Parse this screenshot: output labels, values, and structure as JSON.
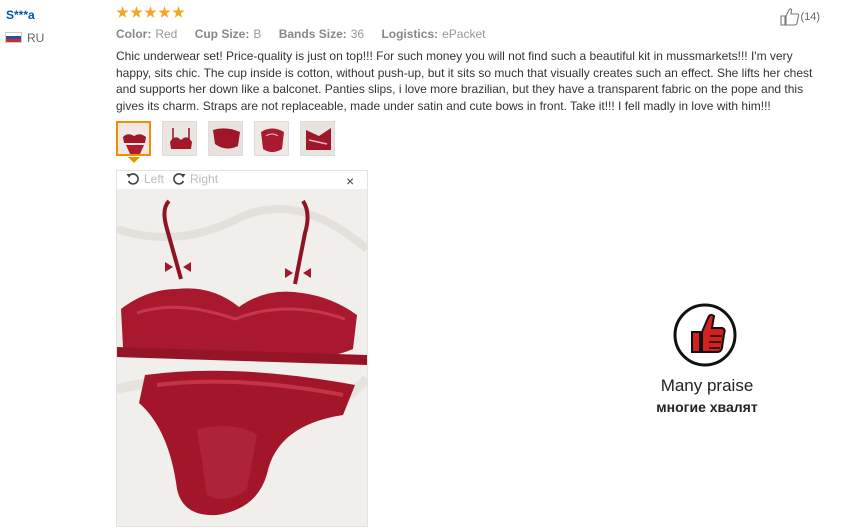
{
  "reviewer": {
    "name": "S***a",
    "country": "RU",
    "flag_colors": [
      "#ffffff",
      "#1c57a5",
      "#d52b1e"
    ]
  },
  "rating": {
    "stars": 5,
    "max": 5,
    "color": "#f5a623"
  },
  "meta": {
    "color_label": "Color:",
    "color_value": "Red",
    "cup_label": "Cup Size:",
    "cup_value": "B",
    "bands_label": "Bands Size:",
    "bands_value": "36",
    "logistics_label": "Logistics:",
    "logistics_value": "ePacket"
  },
  "likes": {
    "icon": "thumbs-up-icon",
    "count": "(14)"
  },
  "review_text": "Chic underwear set! Price-quality is just on top!!! For such money you will not find such a beautiful kit in mussmarkets!!! I'm very happy, sits chic. The cup inside is cotton, without push-up, but it sits so much that visually creates such an effect. She lifts her chest and supports her down like a balconet. Panties slips, i love more brazilian, but they have a transparent fabric on the pope and this gives its charm. Straps are not replaceable, made under satin and cute bows in front. Take it!!! I fell madly in love with him!!!",
  "thumbnails": {
    "count": 5,
    "active_index": 0,
    "accent": "#f09000"
  },
  "viewer": {
    "rotate_left": "Left",
    "rotate_right": "Right",
    "close": "×"
  },
  "badge": {
    "icon": "thumbs-up-badge-icon",
    "en": "Many praise",
    "ru": "многие хвалят",
    "color": "#d32020"
  }
}
